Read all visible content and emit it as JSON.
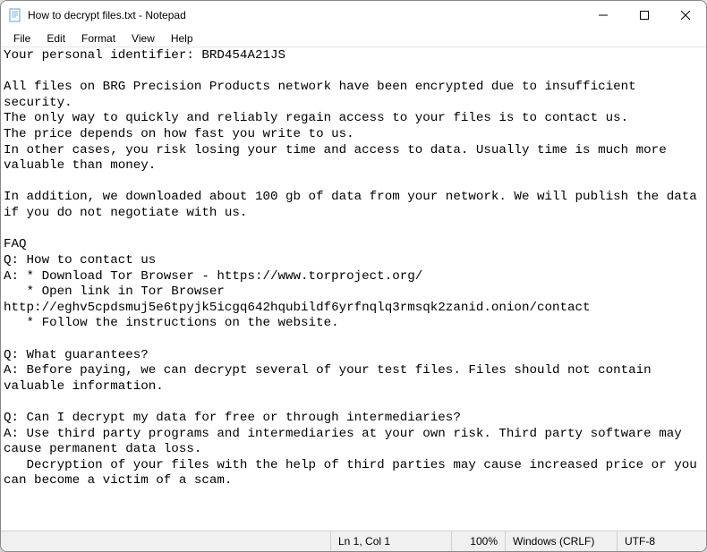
{
  "titlebar": {
    "title": "How to decrypt files.txt - Notepad"
  },
  "menubar": {
    "items": [
      "File",
      "Edit",
      "Format",
      "View",
      "Help"
    ]
  },
  "content": {
    "text": "Your personal identifier: BRD454A21JS\n\nAll files on BRG Precision Products network have been encrypted due to insufficient security.\nThe only way to quickly and reliably regain access to your files is to contact us.\nThe price depends on how fast you write to us.\nIn other cases, you risk losing your time and access to data. Usually time is much more valuable than money.\n\nIn addition, we downloaded about 100 gb of data from your network. We will publish the data if you do not negotiate with us.\n\nFAQ\nQ: How to contact us\nA: * Download Tor Browser - https://www.torproject.org/\n   * Open link in Tor Browser http://eghv5cpdsmuj5e6tpyjk5icgq642hqubildf6yrfnqlq3rmsqk2zanid.onion/contact\n   * Follow the instructions on the website.\n\nQ: What guarantees?\nA: Before paying, we can decrypt several of your test files. Files should not contain valuable information.\n\nQ: Can I decrypt my data for free or through intermediaries?\nA: Use third party programs and intermediaries at your own risk. Third party software may cause permanent data loss.\n   Decryption of your files with the help of third parties may cause increased price or you can become a victim of a scam."
  },
  "statusbar": {
    "position": "Ln 1, Col 1",
    "zoom": "100%",
    "eol": "Windows (CRLF)",
    "encoding": "UTF-8"
  }
}
